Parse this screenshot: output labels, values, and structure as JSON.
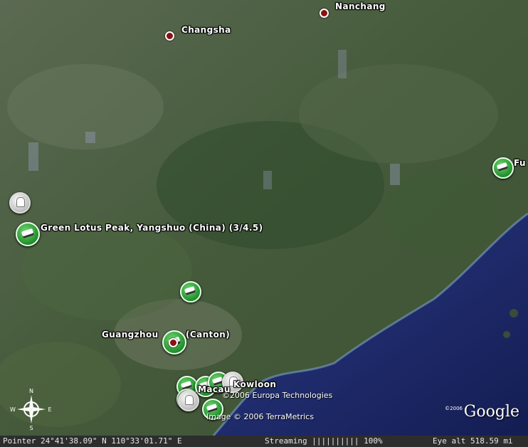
{
  "map": {
    "cities": {
      "nanchang": "Nanchang",
      "changsha": "Changsha",
      "guangzhou": "Guangzhou",
      "canton": "(Canton)",
      "kowloon": "Kowloon",
      "macau": "Macau",
      "fuzhou_partial": "Fu"
    },
    "placemark_label": "Green Lotus Peak, Yangshuo (China) (3/4.5)",
    "credits": {
      "europa": "©2006 Europa Technologies",
      "terrametrics": "Image © 2006 TerraMetrics",
      "google_year": "©2006",
      "google_logo": "Google"
    },
    "compass": {
      "n": "N",
      "s": "S",
      "e": "E",
      "w": "W"
    }
  },
  "status": {
    "pointer": "Pointer  24°41'38.09\" N  110°33'01.71\" E",
    "streaming": "Streaming |||||||||| 100%",
    "eye_alt": "Eye  alt  518.59 mi"
  },
  "colors": {
    "ocean": "#1c2a6b",
    "land": "#4a5a3c",
    "pin": "#2e9a3a",
    "city_dot": "#8b1010"
  }
}
